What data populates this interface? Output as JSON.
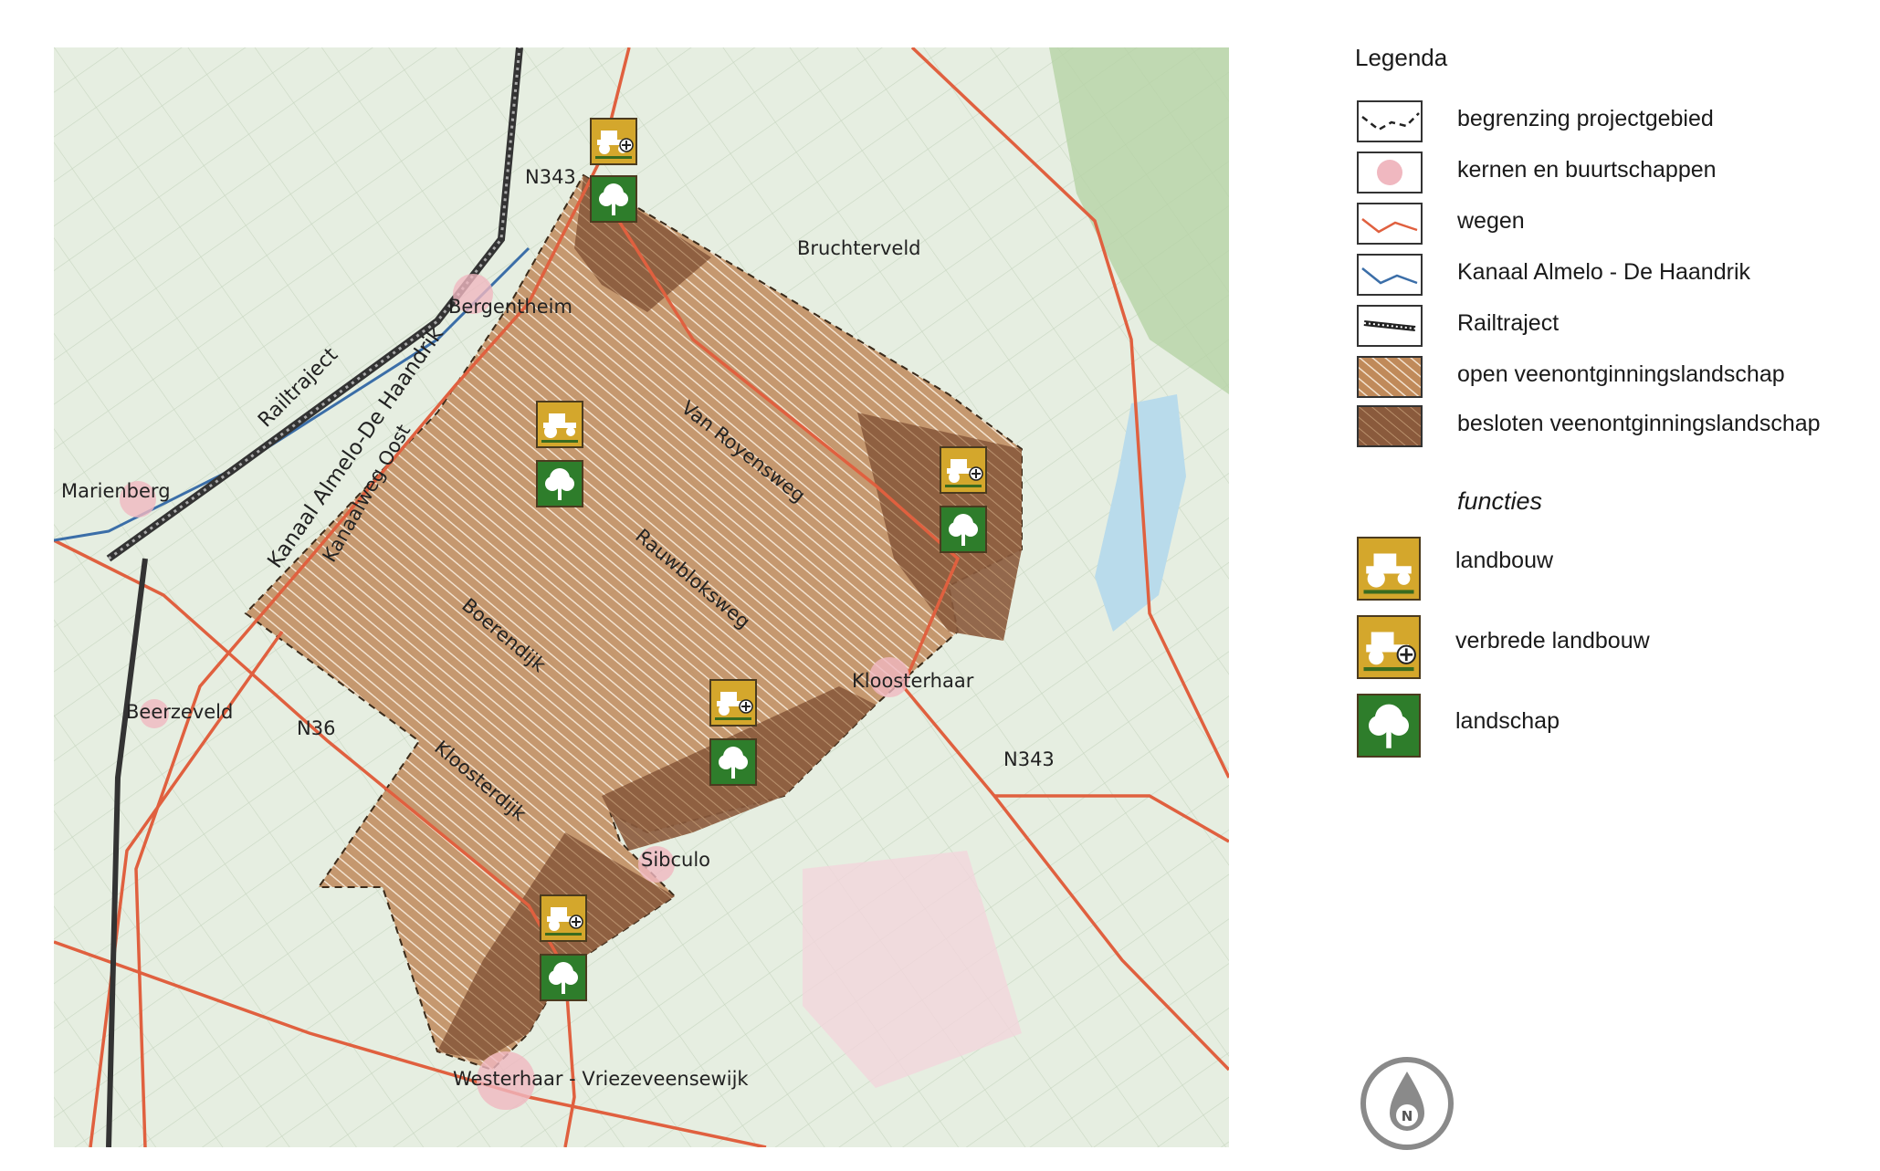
{
  "map": {
    "places": {
      "bruchterveld": "Bruchterveld",
      "bergentheim": "Bergentheim",
      "marienberg": "Marienberg",
      "beerzeveld": "Beerzeveld",
      "kloosterhaar": "Kloosterhaar",
      "sibculo": "Sibculo",
      "westerhaar": "Westerhaar - Vriezeveensewijk"
    },
    "roads": {
      "n343_north": "N343",
      "n343_east": "N343",
      "n36": "N36",
      "van_royensweg": "Van Royensweg",
      "rauwbloksweg": "Rauwbloksweg",
      "boerendijk": "Boerendijk",
      "kloosterdijk": "Kloosterdijk",
      "kanaalweg_oost": "Kanaalweg Oost"
    },
    "canal": "Kanaal Almelo-De Haandrik",
    "rail": "Railtraject",
    "colors": {
      "background": "#e8efe4",
      "road": "#e0603f",
      "canal": "#3b6ea8",
      "open_veen": "#c08a5a",
      "besloten_veen": "#8a5a3c",
      "agri_icon": "#d4a72c",
      "land_icon": "#2e7d2b"
    }
  },
  "legend": {
    "title": "Legenda",
    "items": [
      {
        "label": "begrenzing projectgebied",
        "symbol": "boundary-dashed-icon"
      },
      {
        "label": "kernen en buurtschappen",
        "symbol": "settlement-circle-icon"
      },
      {
        "label": "wegen",
        "symbol": "road-line-icon"
      },
      {
        "label": "Kanaal Almelo - De Haandrik",
        "symbol": "canal-line-icon"
      },
      {
        "label": "Railtraject",
        "symbol": "rail-line-icon"
      },
      {
        "label": "open veenontginningslandschap",
        "symbol": "open-veen-hatch-icon"
      },
      {
        "label": "besloten veenontginningslandschap",
        "symbol": "besloten-veen-hatch-icon"
      }
    ],
    "functies_heading": "functies",
    "functions": [
      {
        "label": "landbouw",
        "icon": "tractor-icon"
      },
      {
        "label": "verbrede landbouw",
        "icon": "tractor-plus-icon"
      },
      {
        "label": "landschap",
        "icon": "tree-icon"
      }
    ]
  },
  "north_arrow": {
    "label": "N"
  }
}
